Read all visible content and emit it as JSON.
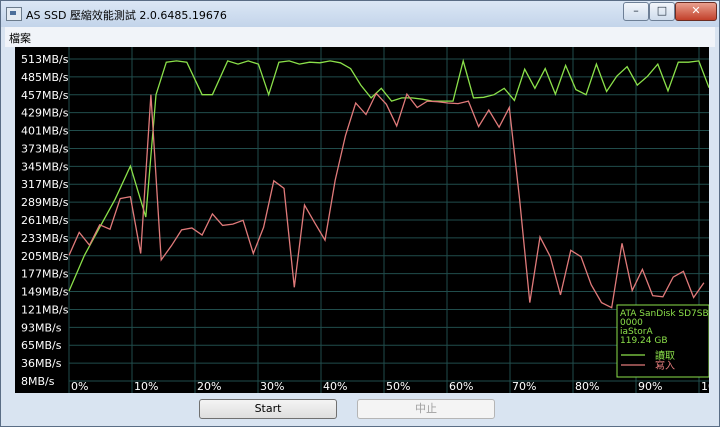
{
  "window": {
    "title": "AS SSD 壓縮效能測試 2.0.6485.19676",
    "minimize": "–",
    "maximize": "□",
    "close": "✕"
  },
  "menu": {
    "items": [
      {
        "label": "檔案"
      }
    ]
  },
  "chart_data": {
    "type": "line",
    "y_ticks": [
      "513MB/s",
      "485MB/s",
      "457MB/s",
      "429MB/s",
      "401MB/s",
      "373MB/s",
      "345MB/s",
      "317MB/s",
      "289MB/s",
      "261MB/s",
      "233MB/s",
      "205MB/s",
      "177MB/s",
      "149MB/s",
      "121MB/s",
      "93MB/s",
      "65MB/s",
      "36MB/s",
      "8MB/s"
    ],
    "x_ticks": [
      "0%",
      "10%",
      "20%",
      "30%",
      "40%",
      "50%",
      "60%",
      "70%",
      "80%",
      "90%",
      "100%"
    ],
    "ylim": [
      8,
      513
    ],
    "xlim": [
      0,
      100
    ],
    "grid": true,
    "legend": {
      "drive": "ATA SanDisk SD7SB",
      "firmware": "0000",
      "driver": "iaStorA",
      "size": "119.24 GB",
      "items": [
        "讀取",
        "寫入"
      ]
    },
    "series": [
      {
        "name": "讀取",
        "color": "#8be04a",
        "values": [
          [
            0,
            149
          ],
          [
            3,
            205
          ],
          [
            6,
            249
          ],
          [
            9,
            293
          ],
          [
            12,
            345
          ],
          [
            15,
            265
          ],
          [
            17,
            457
          ],
          [
            19,
            508
          ],
          [
            21,
            510
          ],
          [
            23,
            508
          ],
          [
            26,
            457
          ],
          [
            28,
            457
          ],
          [
            31,
            510
          ],
          [
            33,
            505
          ],
          [
            35,
            510
          ],
          [
            37,
            505
          ],
          [
            39,
            457
          ],
          [
            41,
            508
          ],
          [
            43,
            510
          ],
          [
            45,
            505
          ],
          [
            47,
            508
          ],
          [
            49,
            507
          ],
          [
            51,
            510
          ],
          [
            53,
            507
          ],
          [
            55,
            498
          ],
          [
            57,
            472
          ],
          [
            59,
            452
          ],
          [
            61,
            467
          ],
          [
            63,
            447
          ],
          [
            65,
            452
          ],
          [
            67,
            452
          ],
          [
            69,
            450
          ],
          [
            71,
            447
          ],
          [
            73,
            447
          ],
          [
            75,
            447
          ],
          [
            77,
            510
          ],
          [
            79,
            452
          ],
          [
            81,
            453
          ],
          [
            83,
            457
          ],
          [
            85,
            467
          ],
          [
            87,
            448
          ],
          [
            89,
            497
          ],
          [
            91,
            467
          ],
          [
            93,
            498
          ],
          [
            95,
            458
          ],
          [
            97,
            503
          ],
          [
            99,
            465
          ],
          [
            101,
            457
          ],
          [
            103,
            505
          ],
          [
            105,
            462
          ],
          [
            107,
            486
          ],
          [
            109,
            501
          ],
          [
            111,
            472
          ],
          [
            113,
            486
          ],
          [
            115,
            505
          ],
          [
            117,
            463
          ],
          [
            119,
            508
          ],
          [
            121,
            508
          ],
          [
            123,
            510
          ],
          [
            125,
            468
          ]
        ]
      },
      {
        "name": "寫入",
        "color": "#e07a7a",
        "values": [
          [
            0,
            205
          ],
          [
            2,
            241
          ],
          [
            4,
            221
          ],
          [
            6,
            253
          ],
          [
            8,
            246
          ],
          [
            10,
            294
          ],
          [
            12,
            297
          ],
          [
            14,
            208
          ],
          [
            16,
            457
          ],
          [
            18,
            198
          ],
          [
            20,
            220
          ],
          [
            22,
            245
          ],
          [
            24,
            248
          ],
          [
            26,
            237
          ],
          [
            28,
            270
          ],
          [
            30,
            252
          ],
          [
            32,
            254
          ],
          [
            34,
            260
          ],
          [
            36,
            208
          ],
          [
            38,
            249
          ],
          [
            40,
            322
          ],
          [
            42,
            310
          ],
          [
            44,
            155
          ],
          [
            46,
            284
          ],
          [
            48,
            256
          ],
          [
            50,
            229
          ],
          [
            52,
            323
          ],
          [
            54,
            393
          ],
          [
            56,
            444
          ],
          [
            58,
            426
          ],
          [
            60,
            459
          ],
          [
            62,
            442
          ],
          [
            64,
            408
          ],
          [
            66,
            458
          ],
          [
            68,
            437
          ],
          [
            70,
            447
          ],
          [
            72,
            446
          ],
          [
            74,
            444
          ],
          [
            76,
            443
          ],
          [
            78,
            447
          ],
          [
            80,
            407
          ],
          [
            82,
            433
          ],
          [
            84,
            406
          ],
          [
            86,
            437
          ],
          [
            88,
            293
          ],
          [
            90,
            131
          ],
          [
            92,
            234
          ],
          [
            94,
            203
          ],
          [
            96,
            143
          ],
          [
            98,
            213
          ],
          [
            100,
            203
          ],
          [
            102,
            159
          ],
          [
            104,
            131
          ],
          [
            106,
            123
          ],
          [
            108,
            224
          ],
          [
            110,
            150
          ],
          [
            112,
            183
          ],
          [
            114,
            142
          ],
          [
            116,
            140
          ],
          [
            118,
            171
          ],
          [
            120,
            180
          ],
          [
            122,
            139
          ],
          [
            124,
            162
          ]
        ]
      }
    ]
  },
  "buttons": {
    "start": "Start",
    "stop": "中止"
  }
}
